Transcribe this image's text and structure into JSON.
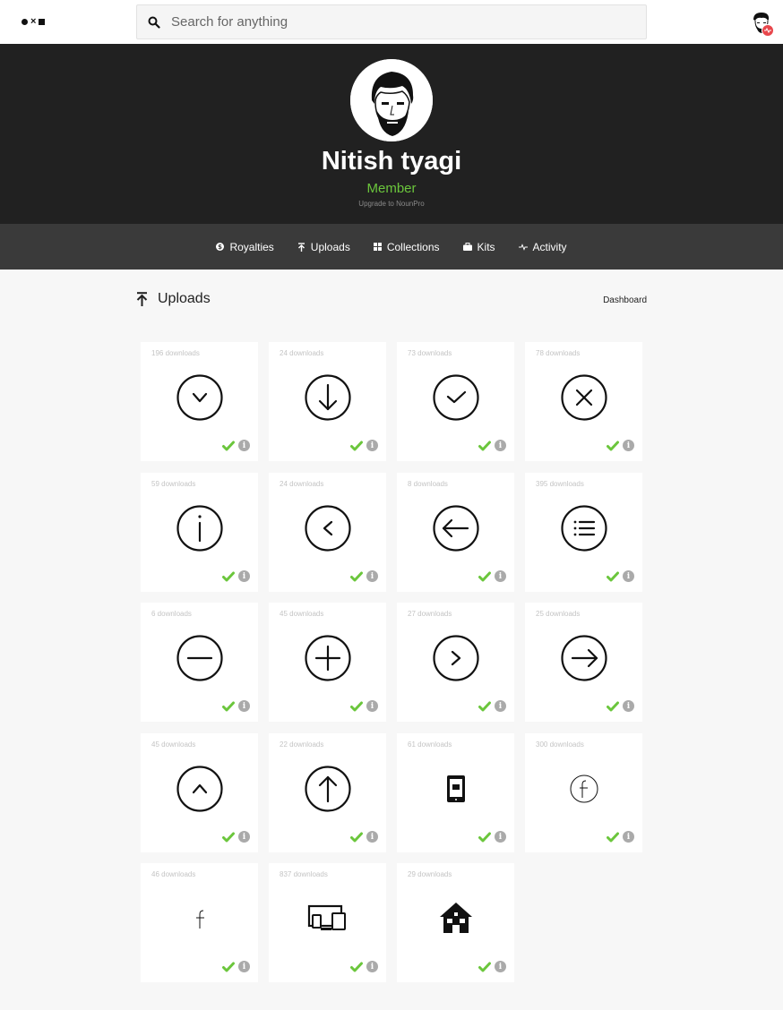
{
  "header": {
    "search_placeholder": "Search for anything"
  },
  "profile": {
    "name": "Nitish tyagi",
    "role": "Member",
    "upgrade_text": "Upgrade to NounPro"
  },
  "tabs": [
    {
      "label": "Royalties",
      "icon": "royalties-icon"
    },
    {
      "label": "Uploads",
      "icon": "upload-icon"
    },
    {
      "label": "Collections",
      "icon": "grid-icon"
    },
    {
      "label": "Kits",
      "icon": "briefcase-icon"
    },
    {
      "label": "Activity",
      "icon": "activity-icon"
    }
  ],
  "section": {
    "title": "Uploads",
    "dashboard_label": "Dashboard"
  },
  "uploads": [
    {
      "downloads": "196 downloads",
      "icon": "circle-chevron-down-icon"
    },
    {
      "downloads": "24 downloads",
      "icon": "circle-arrow-down-icon"
    },
    {
      "downloads": "73 downloads",
      "icon": "circle-check-icon"
    },
    {
      "downloads": "78 downloads",
      "icon": "circle-close-icon"
    },
    {
      "downloads": "59 downloads",
      "icon": "circle-info-icon"
    },
    {
      "downloads": "24 downloads",
      "icon": "circle-chevron-left-icon"
    },
    {
      "downloads": "8 downloads",
      "icon": "circle-arrow-left-icon"
    },
    {
      "downloads": "395 downloads",
      "icon": "circle-list-icon"
    },
    {
      "downloads": "6 downloads",
      "icon": "circle-minus-icon"
    },
    {
      "downloads": "45 downloads",
      "icon": "circle-plus-icon"
    },
    {
      "downloads": "27 downloads",
      "icon": "circle-chevron-right-icon"
    },
    {
      "downloads": "25 downloads",
      "icon": "circle-arrow-right-icon"
    },
    {
      "downloads": "45 downloads",
      "icon": "circle-chevron-up-icon"
    },
    {
      "downloads": "22 downloads",
      "icon": "circle-arrow-up-icon"
    },
    {
      "downloads": "61 downloads",
      "icon": "tablet-icon"
    },
    {
      "downloads": "300 downloads",
      "icon": "circle-facebook-icon"
    },
    {
      "downloads": "46 downloads",
      "icon": "facebook-icon"
    },
    {
      "downloads": "837 downloads",
      "icon": "devices-icon"
    },
    {
      "downloads": "29 downloads",
      "icon": "house-icon"
    }
  ],
  "colors": {
    "hero_bg": "#212121",
    "tabbar_bg": "#3a3a3a",
    "accent_green": "#6bc63c",
    "badge_red": "#e8474c"
  }
}
